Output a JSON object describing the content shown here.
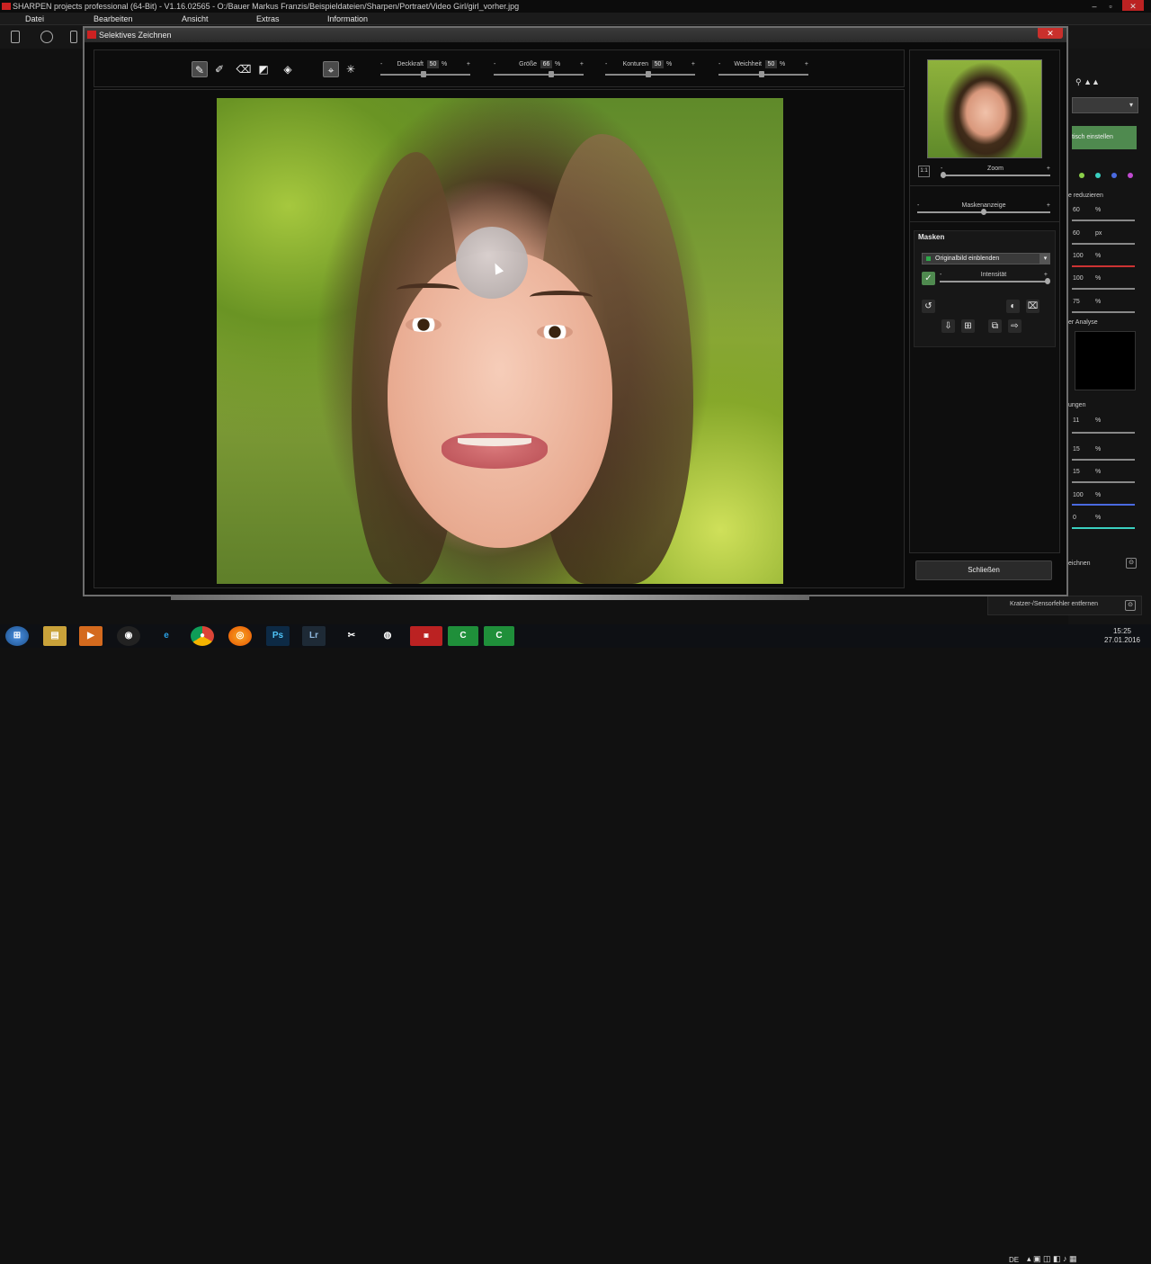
{
  "app": {
    "title": "SHARPEN projects professional (64-Bit) - V1.16.02565 - O:/Bauer Markus Franzis/Beispieldateien/Sharpen/Portraet/Video Girl/girl_vorher.jpg"
  },
  "menu": [
    "Datei",
    "Bearbeiten",
    "Ansicht",
    "Extras",
    "Information"
  ],
  "dialog": {
    "title": "Selektives Zeichnen",
    "close_label": "✕",
    "sliders": [
      {
        "label": "Deckkraft",
        "value": "50",
        "unit": "%",
        "level": 0.5
      },
      {
        "label": "Größe",
        "value": "66",
        "unit": "%",
        "level": 0.66
      },
      {
        "label": "Konturen",
        "value": "50",
        "unit": "%",
        "level": 0.5
      },
      {
        "label": "Weichheit",
        "value": "50",
        "unit": "%",
        "level": 0.5
      }
    ],
    "minus": "-",
    "plus": "+",
    "zoom_label": "Zoom",
    "zoom_level": 0.0,
    "zoom_ratio": "1:1",
    "mask_display_label": "Maskenanzeige",
    "mask_display_level": 0.5,
    "masks": {
      "title": "Masken",
      "selected_option": "Originalbild einblenden",
      "intensity_label": "Intensität",
      "intensity_level": 1.0
    },
    "close_button": "Schließen"
  },
  "right_sidebar": {
    "button": "tisch einstellen",
    "section1": "e reduzieren",
    "values1": [
      {
        "value": "60",
        "unit": "%"
      },
      {
        "value": "60",
        "unit": "px"
      },
      {
        "value": "100",
        "unit": "%"
      },
      {
        "value": "100",
        "unit": "%"
      },
      {
        "value": "75",
        "unit": "%"
      }
    ],
    "section2": "er Analyse",
    "section3": "ungen",
    "values2": [
      {
        "value": "11",
        "unit": "%"
      },
      {
        "value": "15",
        "unit": "%"
      },
      {
        "value": "15",
        "unit": "%"
      },
      {
        "value": "100",
        "unit": "%"
      },
      {
        "value": "0",
        "unit": "%"
      }
    ],
    "item_a": "eichnen",
    "item_b": "Kratzer-/Sensorfehler entfernen"
  },
  "taskbar": {
    "apps": [
      "Ps",
      "Lr"
    ],
    "lang": "DE",
    "time": "15:25",
    "date": "27.01.2016"
  },
  "colors": {
    "accent_green": "#4f8a4f",
    "close_red": "#c9302c"
  }
}
